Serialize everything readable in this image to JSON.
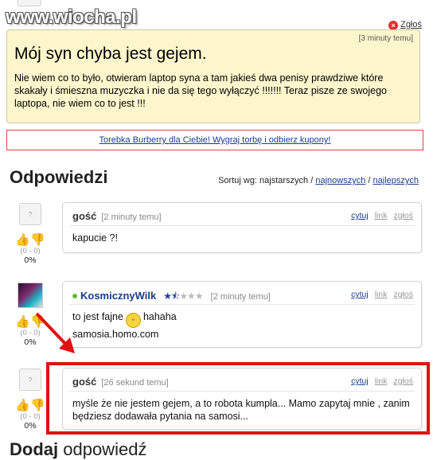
{
  "site": {
    "watermark": "www.wiocha.pl"
  },
  "top": {
    "report_label": "Zgłoś"
  },
  "question": {
    "time": "[3 minuty temu]",
    "title": "Mój syn chyba jest gejem.",
    "body": "Nie wiem co to było, otwieram laptop syna a tam jakieś dwa penisy prawdziwe które skakały i śmieszna muzyczka i nie da się tego wyłączyć !!!!!!! Teraz pisze ze swojego laptopa, nie wiem co to jest !!!"
  },
  "ad": {
    "text": "Torebka Burberry dla Ciebie! Wygraj torbę i odbierz kupony!"
  },
  "answers_section": {
    "heading": "Odpowiedzi",
    "sort_prefix": "Sortuj wg: najstarszych / ",
    "sort_newest": "najnowszych",
    "sort_sep": " / ",
    "sort_best": "najlepszych"
  },
  "answers": [
    {
      "user": "gość",
      "time": "[2 minuty temu]",
      "text": "kapucie ?!",
      "score": "(0 - 0)",
      "percent": "0%",
      "actions": {
        "quote": "cytuj",
        "link": "link",
        "report": "zgłoś"
      }
    },
    {
      "user": "KosmicznyWilk",
      "time": "[2 minuty temu]",
      "text1": "to jest fajne",
      "text1b": "hahaha",
      "text2": "samosia.homo.com",
      "score": "(0 - 0)",
      "percent": "0%",
      "rating_stars_filled": 1.5,
      "rating_stars_total": 5,
      "actions": {
        "quote": "cytuj",
        "link": "link",
        "report": "zgłoś"
      }
    },
    {
      "user": "gość",
      "time": "[26 sekund temu]",
      "text": "myśle że nie jestem gejem, a to robota kumpla... Mamo zapytaj mnie , zanim będziesz dodawała pytania na samosi...",
      "score": "(0 - 0)",
      "percent": "0%",
      "actions": {
        "quote": "cytuj",
        "link": "link",
        "report": "zgłoś"
      }
    }
  ],
  "add_answer": {
    "bold": "Dodaj",
    "rest": " odpowiedź"
  },
  "colors": {
    "highlight": "#e21010",
    "question_bg": "#fdf6cc",
    "link": "#1a3c8c"
  }
}
